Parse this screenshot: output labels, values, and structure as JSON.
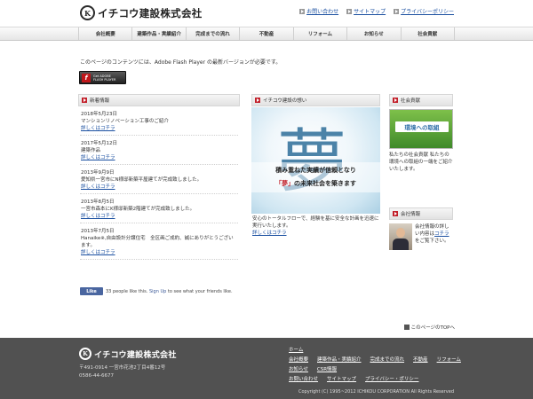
{
  "header": {
    "logo_mark": "K",
    "logo_text": "イチコウ建設株式会社",
    "links": [
      "お問い合わせ",
      "サイトマップ",
      "プライバシーポリシー"
    ]
  },
  "nav": [
    "会社概要",
    "建築作品・実績紹介",
    "完成までの流れ",
    "不動産",
    "リフォーム",
    "お知らせ",
    "社会貢献"
  ],
  "flash": {
    "notice": "このページのコンテンツには、Adobe Flash Player の最新バージョンが必要です。",
    "badge_line1": "Get ADOBE",
    "badge_line2": "FLASH PLAYER"
  },
  "news": {
    "title": "新着情報",
    "items": [
      {
        "date": "2018年5月23日",
        "text": "マンションリノベーション工事のご紹介",
        "link": "詳しくはコチラ"
      },
      {
        "date": "2017年5月12日",
        "text": "建築作品",
        "link": "詳しくはコチラ"
      },
      {
        "date": "2013年9月9日",
        "text": "愛知県一宮市にN様邸新築平屋建てが完成致しました。",
        "link": "詳しくはコチラ"
      },
      {
        "date": "2013年8月5日",
        "text": "一宮市森本にK様邸新築2階建てが完成致しました。",
        "link": "詳しくはコチラ"
      },
      {
        "date": "2013年7月5日",
        "text": "Hanaike※,自由設計分譲住宅　全区画ご成約、誠にありがとうございます。",
        "link": "詳しくはコチラ"
      }
    ]
  },
  "facebook": {
    "like": "Like",
    "text": "33 people like this.",
    "signup": "Sign Up",
    "rest": "to see what your friends like."
  },
  "vision": {
    "title": "イチコウ建設の想い",
    "big_char": "夢",
    "line1": "積み重ねた実績が信頼となり",
    "line2_hl": "「夢」",
    "line2_rest": "の未来社会を築きます",
    "desc": "安心のトータルフローで、経験を基に安全な計画を迅速に実行いたします。",
    "link": "詳しくはコチラ"
  },
  "social": {
    "title": "社会貢献",
    "image_label": "環境への取組",
    "text": "私たちの社会貢献 私たちの環境への取組の一端をご紹介いたします。"
  },
  "company": {
    "title": "会社情報",
    "text1": "会社情報の詳しい内容は",
    "link": "コチラ",
    "text2": "をご覧下さい。"
  },
  "to_top": "このページのTOPへ",
  "footer": {
    "logo_mark": "K",
    "logo_text": "イチコウ建設株式会社",
    "zip": "〒491-0914 一宮市花池2丁目4番12号",
    "tel": "0586-44-6677",
    "links_row1": [
      "ホーム"
    ],
    "links_row2": [
      "会社概要",
      "建築作品・実績紹介",
      "完成までの流れ",
      "不動産",
      "リフォーム"
    ],
    "links_row3": [
      "お知らせ",
      "CSR情報"
    ],
    "links_row4": [
      "お問い合わせ",
      "サイトマップ",
      "プライバシー・ポリシー"
    ],
    "copyright": "Copyright (C) 1995~2012 ICHIKOU CORPORATION All Rights Reserved"
  }
}
